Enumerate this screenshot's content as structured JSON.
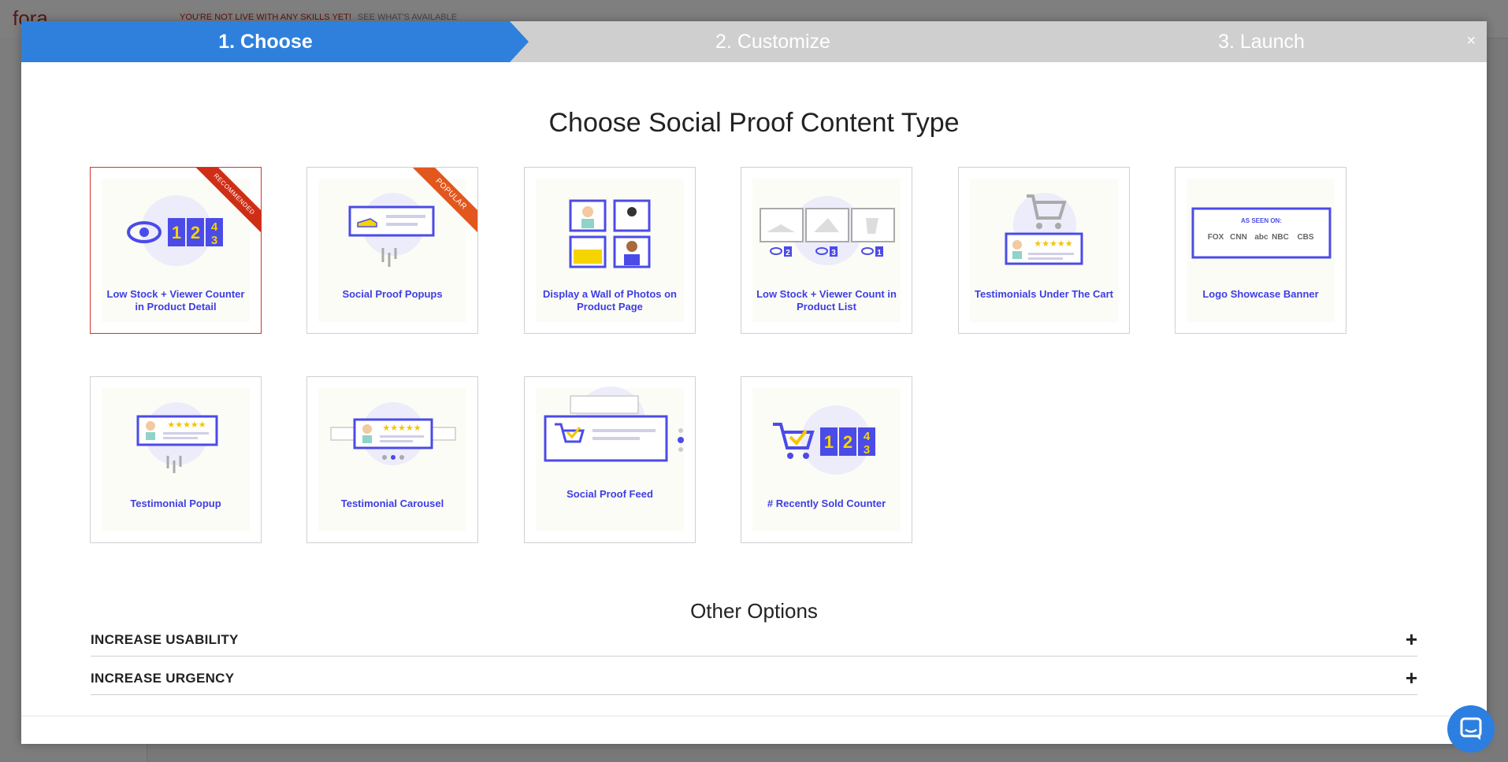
{
  "background": {
    "logo": "fora",
    "alert": "YOU'RE NOT LIVE WITH ANY SKILLS YET!",
    "alert_link": "SEE WHAT'S AVAILABLE"
  },
  "steps": [
    {
      "label": "1. Choose"
    },
    {
      "label": "2. Customize"
    },
    {
      "label": "3. Launch"
    }
  ],
  "close_icon": "×",
  "heading": "Choose Social Proof Content Type",
  "cards": [
    {
      "label": "Low Stock + Viewer Counter in Product Detail",
      "ribbon": "RECOMMENDED"
    },
    {
      "label": "Social Proof Popups",
      "ribbon": "POPULAR"
    },
    {
      "label": "Display a Wall of Photos on Product Page"
    },
    {
      "label": "Low Stock + Viewer Count in Product List"
    },
    {
      "label": "Testimonials Under The Cart"
    },
    {
      "label": "Logo Showcase Banner"
    },
    {
      "label": "Testimonial Popup"
    },
    {
      "label": "Testimonial Carousel"
    },
    {
      "label": "Social Proof Feed"
    },
    {
      "label": "# Recently Sold Counter"
    }
  ],
  "illustration_text": {
    "counter_digits": [
      "1",
      "2",
      "4",
      "3"
    ],
    "viewer_counts": [
      "2",
      "3",
      "1"
    ],
    "as_seen_on": "AS SEEN ON:",
    "logos": [
      "FOX",
      "CNN",
      "abc",
      "NBC",
      "CBS"
    ]
  },
  "other_options": {
    "heading": "Other Options",
    "items": [
      {
        "label": "INCREASE USABILITY",
        "icon": "+"
      },
      {
        "label": "INCREASE URGENCY",
        "icon": "+"
      }
    ]
  },
  "colors": {
    "active_step": "#2f80dc",
    "inactive_step": "#cfcfcf",
    "accent": "#3d3ee6",
    "selected_border": "#d1332b",
    "ribbon": "#e2571e"
  }
}
